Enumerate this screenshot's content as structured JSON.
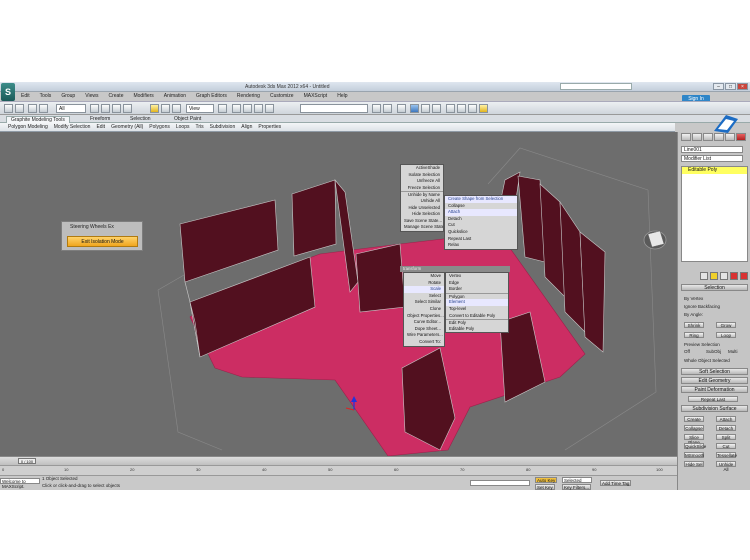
{
  "app": {
    "icon_letter": "S",
    "title": "Autodesk 3ds Max 2012 x64 - Untitled",
    "sign_in": "Sign In"
  },
  "menu": [
    "Edit",
    "Tools",
    "Group",
    "Views",
    "Create",
    "Modifiers",
    "Animation",
    "Graph Editors",
    "Rendering",
    "Customize",
    "MAXScript",
    "Help"
  ],
  "toolbar": {
    "selection_filter": "All",
    "reference_coord": "View"
  },
  "ribbon": {
    "tabs": [
      "Graphite Modeling Tools",
      "Freeform",
      "Selection",
      "Object Paint"
    ],
    "items": [
      "Polygon Modeling",
      "Modify Selection",
      "Edit",
      "Geometry (All)",
      "Polygons",
      "Loops",
      "Tris",
      "Subdivision",
      "Align",
      "Properties"
    ]
  },
  "viewport": {
    "label": "",
    "floating_panel": {
      "title": "Steering Wheels Ex",
      "button": "Exit Isolation Mode"
    }
  },
  "quad_menu": {
    "top_left": [
      "ActiveShade",
      "Isolate Selection",
      "Unfreeze All",
      "Freeze Selection",
      "Unhide by Name",
      "Unhide All",
      "Hide Unselected",
      "Hide Selection",
      "Save Scene State...",
      "Manage Scene States..."
    ],
    "top_right": [
      "Create Shape from Selection",
      "Collapse",
      "Attach",
      "Detach",
      "Cut",
      "Quickslice",
      "Repeat Last",
      "Relax",
      "Divide",
      "Extrude",
      "Bevel",
      "Outline"
    ],
    "bottom_left": [
      "Move",
      "Rotate",
      "Scale",
      "Select",
      "Select Similar",
      "Clone",
      "Object Properties...",
      "Curve Editor...",
      "Dope Sheet...",
      "Wire Parameters...",
      "Convert To:"
    ],
    "bottom_right": [
      "Vertex",
      "Edge",
      "Border",
      "Polygon",
      "Element",
      "Top-level",
      "Convert to Editable Poly",
      "Edit Poly",
      "Editable Poly"
    ],
    "quad_titles": [
      "transform",
      "tools 1"
    ]
  },
  "command_panel": {
    "object_name": "Line001",
    "modifier_list_label": "Modifier List",
    "modifier_stack": [
      "Editable Poly"
    ],
    "rollouts": [
      "Selection",
      "Soft Selection",
      "Edit Geometry",
      "Paint Deformation",
      "Subdivision Surface"
    ],
    "labels": [
      "By Vertex",
      "Ignore Backfacing",
      "By Angle:",
      "Shrink",
      "Grow",
      "Ring",
      "Loop",
      "Preview Selection",
      "Off",
      "SubObj",
      "Multi",
      "Whole Object Selected"
    ],
    "buttons": [
      "Repeat Last",
      "Create",
      "Attach",
      "Collapse",
      "Detach",
      "Slice Plane",
      "Split",
      "QuickSlice",
      "Cut",
      "MSmooth",
      "Tessellate",
      "Hide Sel",
      "Unhide All"
    ]
  },
  "timeline": {
    "slider_label": "0 / 100",
    "ticks": [
      "0",
      "10",
      "20",
      "30",
      "40",
      "50",
      "60",
      "70",
      "80",
      "90",
      "100"
    ]
  },
  "status": {
    "maxscript": "Welcome to MAXScript.",
    "line1": "1 Object Selected",
    "line2": "Click or click-and-drag to select objects",
    "auto_key": "Auto Key",
    "set_key": "Set Key",
    "key_filters": "Key Filters...",
    "selected": "Selected",
    "add_time_tag": "Add Time Tag"
  },
  "colors": {
    "floor": "#cc2d63",
    "walls": "#52101f",
    "viewport_bg": "#6d6d6d"
  }
}
